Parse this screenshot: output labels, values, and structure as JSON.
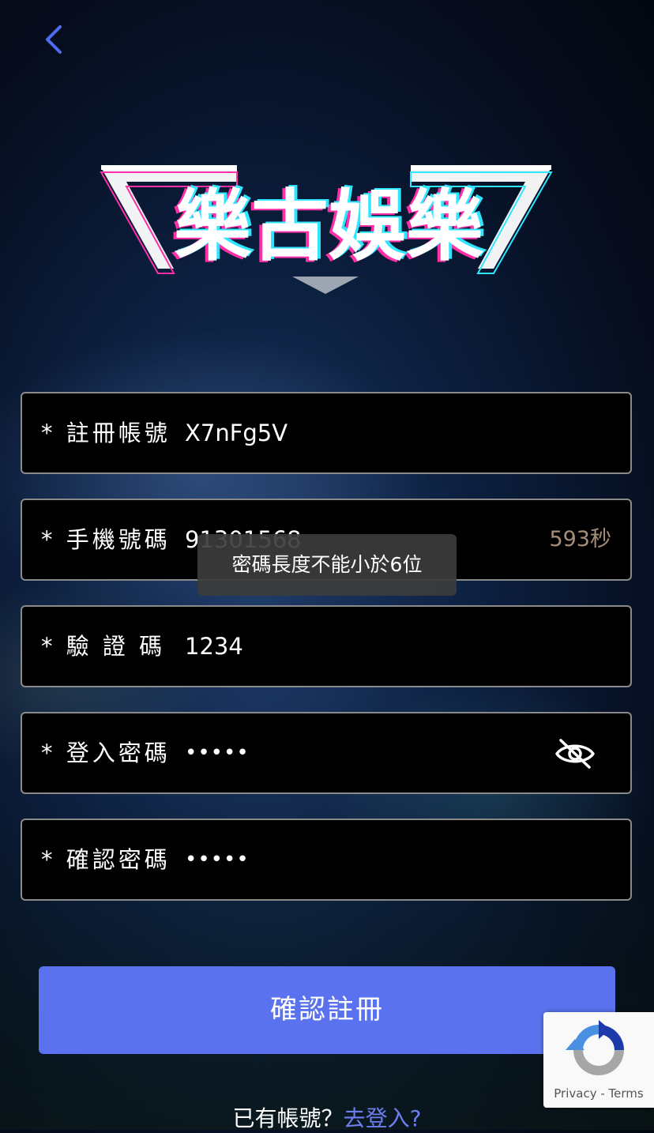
{
  "nav": {
    "back_icon": "chevron-left-icon"
  },
  "logo": {
    "text": "樂古娛樂"
  },
  "form": {
    "account": {
      "label": "* 註冊帳號",
      "value": "X7nFg5V"
    },
    "phone": {
      "label": "* 手機號碼",
      "value": "91301568",
      "countdown": "593秒"
    },
    "code": {
      "label": "* 驗 證 碼",
      "value": "1234"
    },
    "password": {
      "label": "* 登入密碼",
      "value": "•••••",
      "toggle_icon": "eye-slash-icon"
    },
    "confirm": {
      "label": "* 確認密碼",
      "value": "•••••"
    }
  },
  "toast": {
    "message": "密碼長度不能小於6位"
  },
  "submit": {
    "label": "確認註冊"
  },
  "footer": {
    "text": "已有帳號？",
    "link": "去登入?"
  },
  "recaptcha": {
    "privacy": "Privacy",
    "separator": " - ",
    "terms": "Terms"
  },
  "colors": {
    "accent": "#5a72ee",
    "link": "#6d7ff0",
    "countdown": "#a58e78",
    "field_bg": "#000000"
  }
}
